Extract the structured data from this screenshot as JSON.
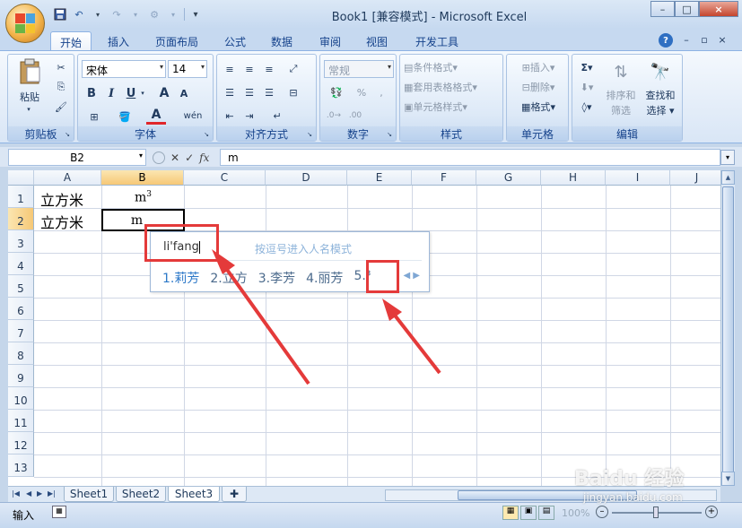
{
  "window": {
    "title": "Book1  [兼容模式] - Microsoft Excel",
    "controls": [
      "–",
      "□",
      "×"
    ]
  },
  "qat": {
    "save": "💾",
    "undo": "↶",
    "redo": "↷",
    "more": "▾"
  },
  "tabs": [
    {
      "label": "开始",
      "active": true
    },
    {
      "label": "插入"
    },
    {
      "label": "页面布局"
    },
    {
      "label": "公式"
    },
    {
      "label": "数据"
    },
    {
      "label": "审阅"
    },
    {
      "label": "视图"
    },
    {
      "label": "开发工具"
    }
  ],
  "ribbon": {
    "clipboard": {
      "label": "剪贴板",
      "paste": "粘贴"
    },
    "font": {
      "label": "字体",
      "name": "宋体",
      "size": "14",
      "bold": "B",
      "italic": "I",
      "underline": "U",
      "grow": "A",
      "shrink": "A",
      "color": "A",
      "phonetic": "wén"
    },
    "alignment": {
      "label": "对齐方式"
    },
    "number": {
      "label": "数字",
      "format": "常规",
      "percent": "%",
      "comma": ","
    },
    "styles": {
      "label": "样式",
      "cond": "条件格式",
      "table": "套用表格格式",
      "cell": "单元格样式"
    },
    "cells": {
      "label": "单元格",
      "insert": "插入",
      "delete": "删除",
      "format": "格式"
    },
    "editing": {
      "label": "编辑",
      "sort": "排序和",
      "sort2": "筛选",
      "find": "查找和",
      "find2": "选择"
    }
  },
  "formula": {
    "namebox": "B2",
    "fx": "fx",
    "value": "m"
  },
  "columns": [
    "A",
    "B",
    "C",
    "D",
    "E",
    "F",
    "G",
    "H",
    "I",
    "J"
  ],
  "rows": [
    "1",
    "2",
    "3",
    "4",
    "5",
    "6",
    "7",
    "8",
    "9",
    "10",
    "11",
    "12",
    "13"
  ],
  "cells": {
    "a1": "立方米",
    "b1": "m",
    "b1_sup": "3",
    "a2": "立方米",
    "b2": "m"
  },
  "ime": {
    "pinyin": "li'fang",
    "hint": "按逗号进入人名模式",
    "candidates": [
      "1.莉芳",
      "2.立方",
      "3.李芳",
      "4.丽芳",
      "5.³"
    ]
  },
  "sheets": [
    "Sheet1",
    "Sheet2",
    "Sheet3"
  ],
  "status": {
    "mode": "输入",
    "zoom": "100%"
  },
  "colors": {
    "accent": "#e43a3a",
    "ribbon": "#dbe8f6"
  }
}
